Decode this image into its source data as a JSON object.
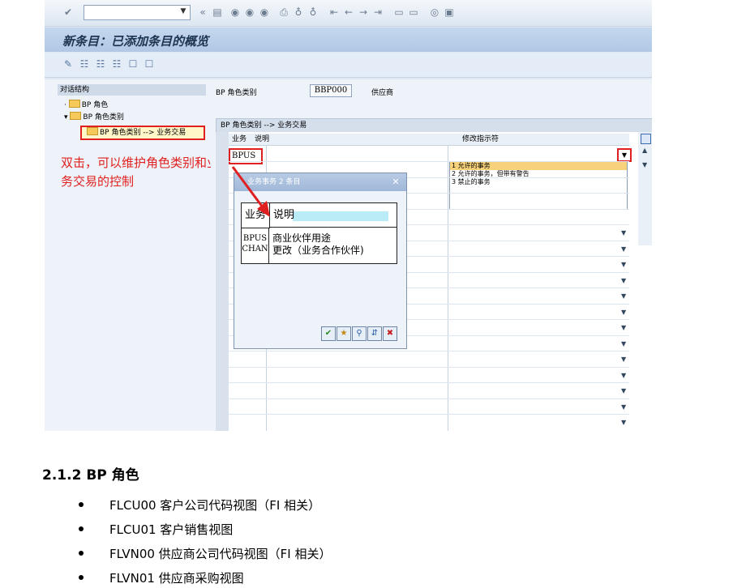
{
  "sap": {
    "title": "新条目：已添加条目的概览",
    "left_pane": {
      "header": "对话结构",
      "tree": [
        "BP 角色",
        "BP 角色类别",
        "BP 角色类别 --> 业务交易"
      ]
    },
    "right_pane": {
      "role_category_label": "BP 角色类别",
      "role_category_value": "BBP000",
      "role_category_desc": "供应商",
      "table_title": "BP 角色类别 --> 业务交易",
      "col_transaction": "业务",
      "col_desc": "说明",
      "col_modifier": "修改指示符",
      "first_row_code": "BPUS",
      "dropdown_options": [
        "1 允许的事务",
        "2 允许的事务，但带有警告",
        "3 禁止的事务"
      ]
    },
    "annotation": "双击，可以维护角色类别和业务交易的控制",
    "popup": {
      "title": "业务事务 2 条目",
      "col_code": "业务",
      "col_desc": "说明",
      "rows": [
        {
          "code": "BPUS",
          "desc": "商业伙伴用途"
        },
        {
          "code": "CHAN",
          "desc": "更改（业务合作伙伴)"
        }
      ]
    }
  },
  "doc": {
    "heading": "2.1.2 BP 角色",
    "bullets": [
      "FLCU00  客户公司代码视图（FI 相关）",
      "FLCU01  客户销售视图",
      "FLVN00  供应商公司代码视图（FI 相关）",
      "FLVN01  供应商采购视图"
    ]
  }
}
